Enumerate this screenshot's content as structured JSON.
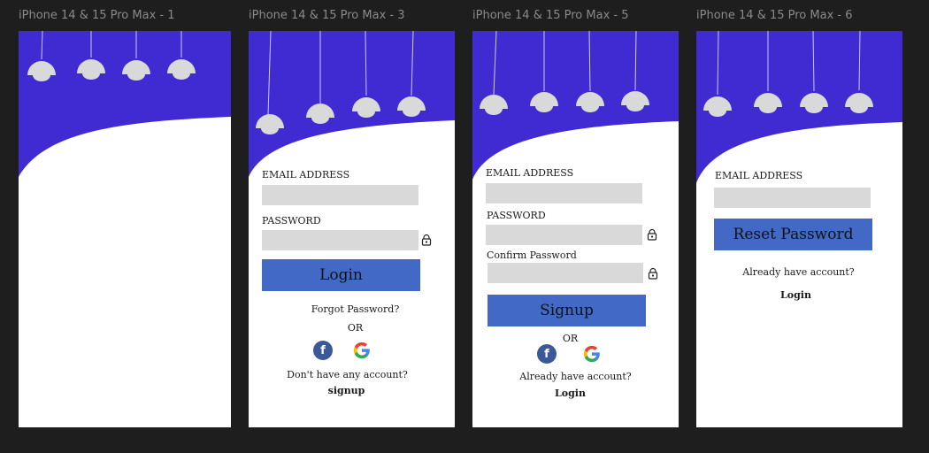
{
  "frames": [
    {
      "title": "iPhone 14 & 15 Pro Max - 1"
    },
    {
      "title": "iPhone 14 & 15 Pro Max - 3",
      "email_label": "EMAIL ADDRESS",
      "password_label": "PASSWORD",
      "login_button": "Login",
      "forgot_link": "Forgot Password?",
      "or_text": "OR",
      "facebook_icon": "f",
      "no_account_text": "Don't have any account?",
      "signup_link": "signup"
    },
    {
      "title": "iPhone 14 & 15 Pro Max - 5",
      "email_label": "EMAIL ADDRESS",
      "password_label": "PASSWORD",
      "confirm_label": "Confirm Password",
      "signup_button": "Signup",
      "or_text": "OR",
      "facebook_icon": "f",
      "have_account_text": "Already have account?",
      "login_link": "Login"
    },
    {
      "title": "iPhone 14 & 15 Pro Max - 6",
      "email_label": "EMAIL ADDRESS",
      "reset_button": "Reset Password",
      "have_account_text": "Already have account?",
      "login_link": "Login"
    }
  ],
  "colors": {
    "canvas": "#1e1e1e",
    "header": "#3f2bd1",
    "lamp": "#d9d9d9",
    "input": "#d9d9d9",
    "button": "#4169c5",
    "facebook": "#3b5998"
  },
  "icons": [
    "lamp-icon",
    "lock-icon",
    "facebook-icon",
    "google-icon"
  ]
}
